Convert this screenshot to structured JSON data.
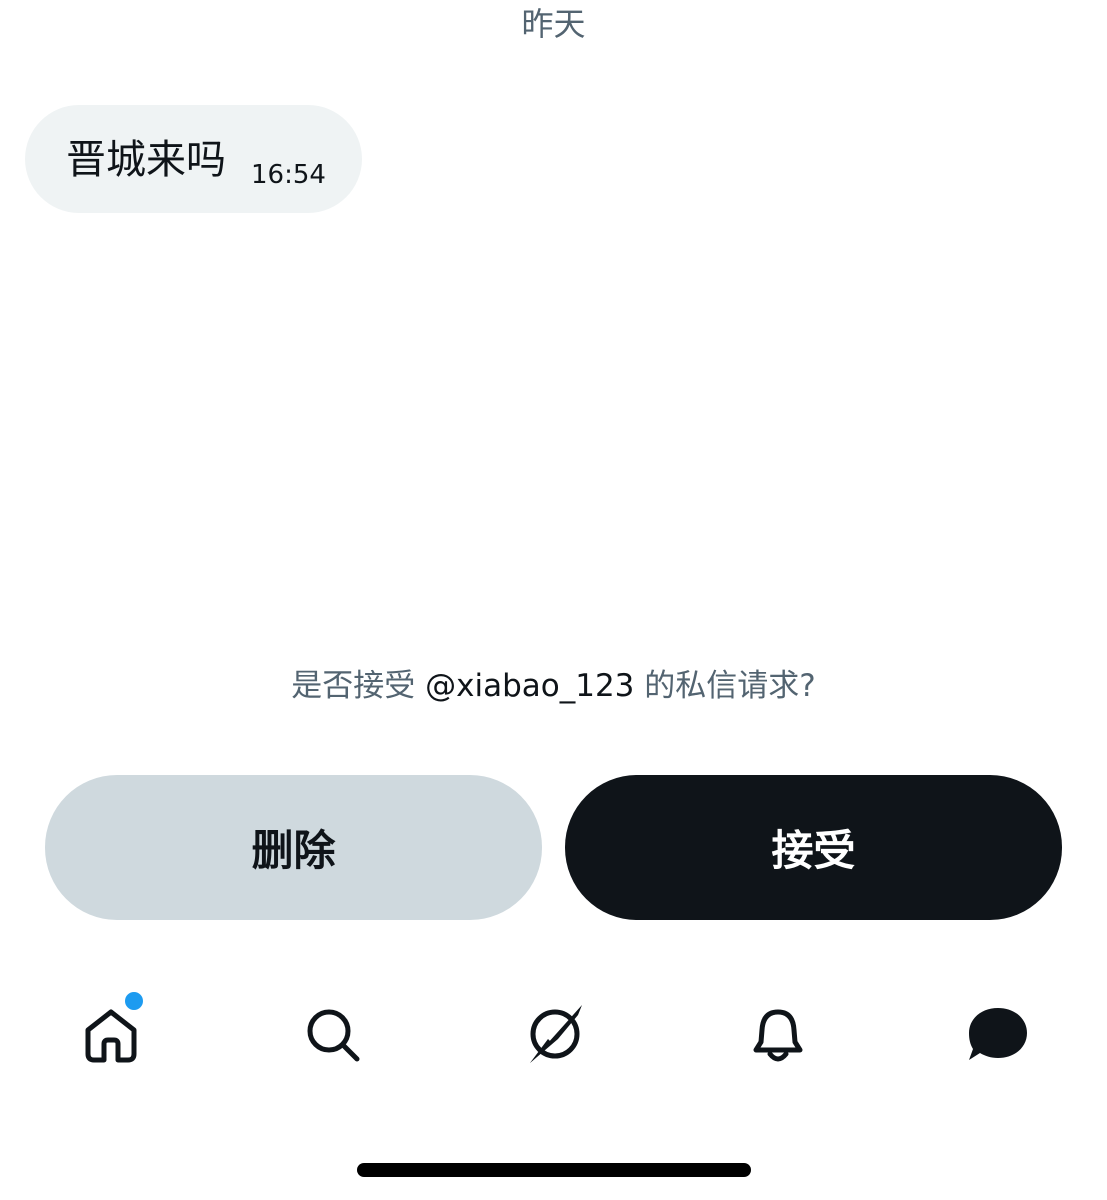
{
  "conversation": {
    "date_divider": "昨天",
    "messages": [
      {
        "text": "晋城来吗",
        "time": "16:54"
      }
    ]
  },
  "request": {
    "prompt_prefix": "是否接受",
    "handle": "@xiabao_123",
    "prompt_suffix": "的私信请求?"
  },
  "actions": {
    "delete_label": "删除",
    "accept_label": "接受"
  },
  "tabbar": {
    "items": [
      {
        "icon": "home-icon",
        "has_notification_dot": true
      },
      {
        "icon": "search-icon"
      },
      {
        "icon": "grok-icon"
      },
      {
        "icon": "bell-icon"
      },
      {
        "icon": "messages-icon",
        "active": true
      }
    ]
  },
  "colors": {
    "text_primary": "#0f1419",
    "text_secondary": "#536471",
    "bubble_bg": "#eff3f4",
    "delete_bg": "#cfd9de",
    "accept_bg": "#0f1419",
    "notification_dot": "#1d9bf0"
  }
}
